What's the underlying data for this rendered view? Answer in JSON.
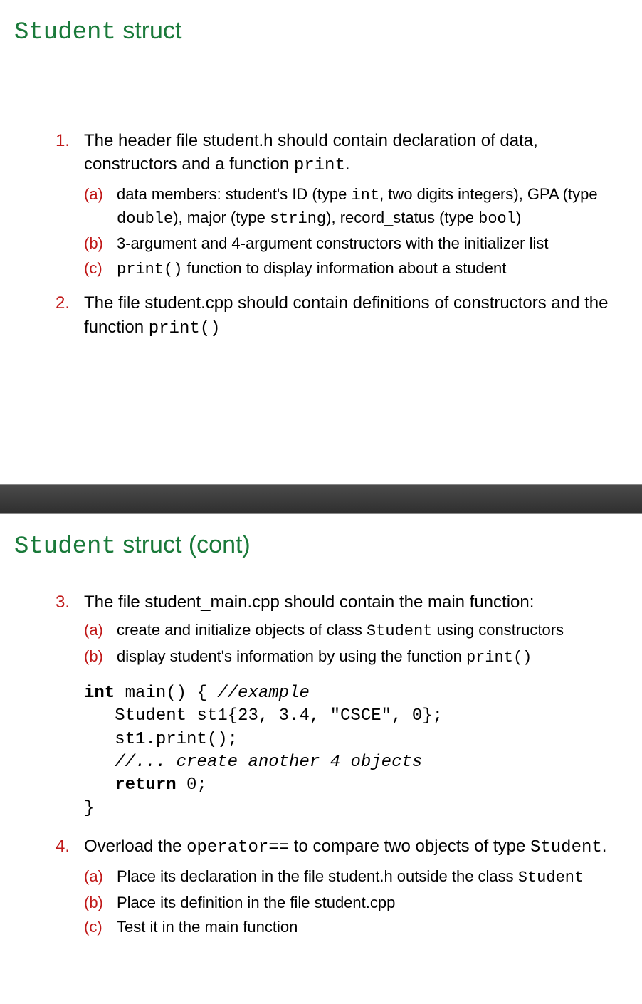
{
  "slide1": {
    "title_mono": "Student",
    "title_rest": " struct",
    "items": [
      {
        "marker": "1.",
        "text_parts": [
          "The header file student.h should contain declaration of data, constructors and a function ",
          "print",
          "."
        ],
        "sub": [
          {
            "marker": "(a)",
            "parts": [
              "data members: student's ID (type ",
              "int",
              ", two digits integers), GPA (type ",
              "double",
              "), major (type ",
              "string",
              "), record_status (type ",
              "bool",
              ")"
            ]
          },
          {
            "marker": "(b)",
            "parts": [
              "3-argument and 4-argument constructors with the initializer list"
            ]
          },
          {
            "marker": "(c)",
            "parts": [
              "",
              "print()",
              " function to display information about a student"
            ]
          }
        ]
      },
      {
        "marker": "2.",
        "text_parts": [
          "The file student.cpp should contain definitions of constructors and the function ",
          "print()",
          ""
        ],
        "sub": []
      }
    ]
  },
  "slide2": {
    "title_mono": "Student",
    "title_rest": " struct (cont)",
    "items": [
      {
        "marker": "3.",
        "text_parts": [
          "The file student_main.cpp should contain the main function:"
        ],
        "sub": [
          {
            "marker": "(a)",
            "parts": [
              "create and initialize objects of class ",
              "Student",
              " using constructors"
            ]
          },
          {
            "marker": "(b)",
            "parts": [
              "display student's information by using the function ",
              "print()",
              ""
            ]
          }
        ],
        "code": {
          "l1_kw": "int",
          "l1_rest": " main() { ",
          "l1_cm": "//example",
          "l2": "   Student st1{23, 3.4, \"CSCE\", 0};",
          "l3": "   st1.print();",
          "l4_cm": "   //... create another 4 objects",
          "l5_kw": "   return",
          "l5_rest": " 0;",
          "l6": "}"
        }
      },
      {
        "marker": "4.",
        "text_parts": [
          "Overload the ",
          "operator==",
          " to compare two objects of type ",
          "Student",
          "."
        ],
        "sub": [
          {
            "marker": "(a)",
            "parts": [
              "Place its declaration in the file student.h outside the class ",
              "Student",
              ""
            ]
          },
          {
            "marker": "(b)",
            "parts": [
              "Place its definition in the file student.cpp"
            ]
          },
          {
            "marker": "(c)",
            "parts": [
              "Test it in the main function"
            ]
          }
        ]
      }
    ]
  }
}
